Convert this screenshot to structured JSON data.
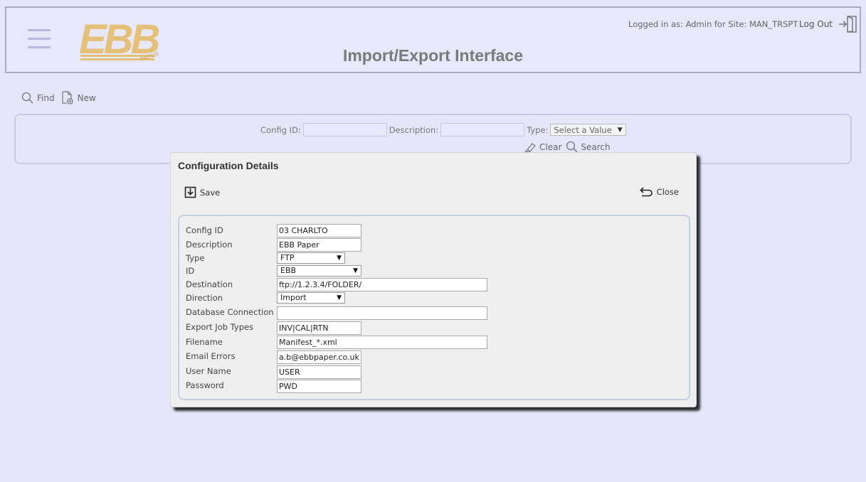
{
  "header": {
    "logo_text": "EBB",
    "logo_sub": "PAPER",
    "title": "Import/Export Interface",
    "login_info": "Logged in as: Admin for Site: MAN_TRSPT",
    "logout_label": "Log Out"
  },
  "toolbar": {
    "find_label": "Find",
    "new_label": "New"
  },
  "search": {
    "config_id_label": "Config ID:",
    "config_id_value": "",
    "description_label": "Description:",
    "description_value": "",
    "type_label": "Type:",
    "type_value": "Select a Value",
    "clear_label": "Clear",
    "search_label": "Search"
  },
  "modal": {
    "title": "Configuration Details",
    "save_label": "Save",
    "close_label": "Close",
    "fields": {
      "config_id": {
        "label": "Config ID",
        "value": "03 CHARLTO"
      },
      "description": {
        "label": "Description",
        "value": "EBB Paper"
      },
      "type": {
        "label": "Type",
        "value": "FTP"
      },
      "id": {
        "label": "ID",
        "value": "EBB"
      },
      "destination": {
        "label": "Destination",
        "value": "ftp://1.2.3.4/FOLDER/"
      },
      "direction": {
        "label": "Direction",
        "value": "Import"
      },
      "db_connection": {
        "label": "Database Connection",
        "value": ""
      },
      "export_job_types": {
        "label": "Export Job Types",
        "value": "INV|CAL|RTN"
      },
      "filename": {
        "label": "Filename",
        "value": "Manifest_*.xml"
      },
      "email_errors": {
        "label": "Email Errors",
        "value": "a.b@ebbpaper.co.uk"
      },
      "user_name": {
        "label": "User Name",
        "value": "USER"
      },
      "password": {
        "label": "Password",
        "value": "PWD"
      }
    }
  },
  "icons": {
    "menu": "hamburger-icon",
    "logout": "logout-icon",
    "find": "search-icon",
    "new": "new-document-icon",
    "clear": "eraser-icon",
    "search": "search-icon",
    "save": "save-icon",
    "close": "undo-icon"
  },
  "colors": {
    "background": "#e6e6fb",
    "logo": "#e5c178",
    "modal": "#efefef",
    "panel_border": "#c4cfe4"
  }
}
